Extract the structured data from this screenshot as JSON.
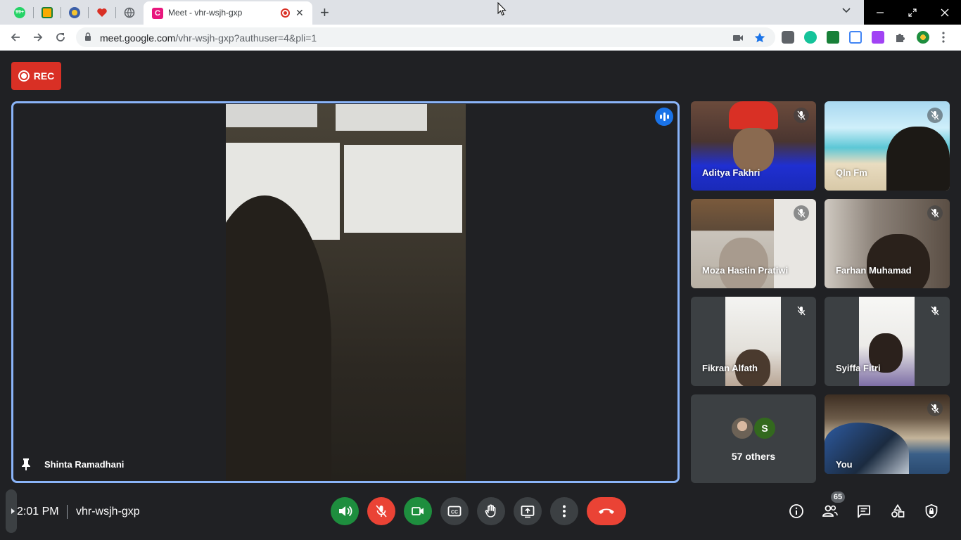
{
  "browser": {
    "active_tab_title": "Meet - vhr-wsjh-gxp",
    "favicon_letter": "C",
    "pinned_tab_badge": "99+",
    "url_host": "meet.google.com",
    "url_path": "/vhr-wsjh-gxp?authuser=4&pli=1",
    "accent": "#1a73e8"
  },
  "meet": {
    "rec_label": "REC",
    "main_speaker": "Shinta Ramadhani",
    "participants": [
      {
        "name": "Aditya Fakhri",
        "muted": true
      },
      {
        "name": "Qln Fm",
        "muted": true
      },
      {
        "name": "Moza Hastin Pratiwi",
        "muted": true
      },
      {
        "name": "Farhan Muhamad",
        "muted": true
      },
      {
        "name": "Fikran Alfath",
        "muted": true
      },
      {
        "name": "Syiffa Fitri",
        "muted": true
      }
    ],
    "others_label": "57 others",
    "others_avatar_letter": "S",
    "self_label": "You",
    "time": "2:01 PM",
    "meeting_code": "vhr-wsjh-gxp",
    "participant_count": "65",
    "colors": {
      "record_red": "#d93025",
      "active_border": "#8ab4f8",
      "green": "#1e8e3e",
      "hangup_red": "#ea4335"
    }
  }
}
